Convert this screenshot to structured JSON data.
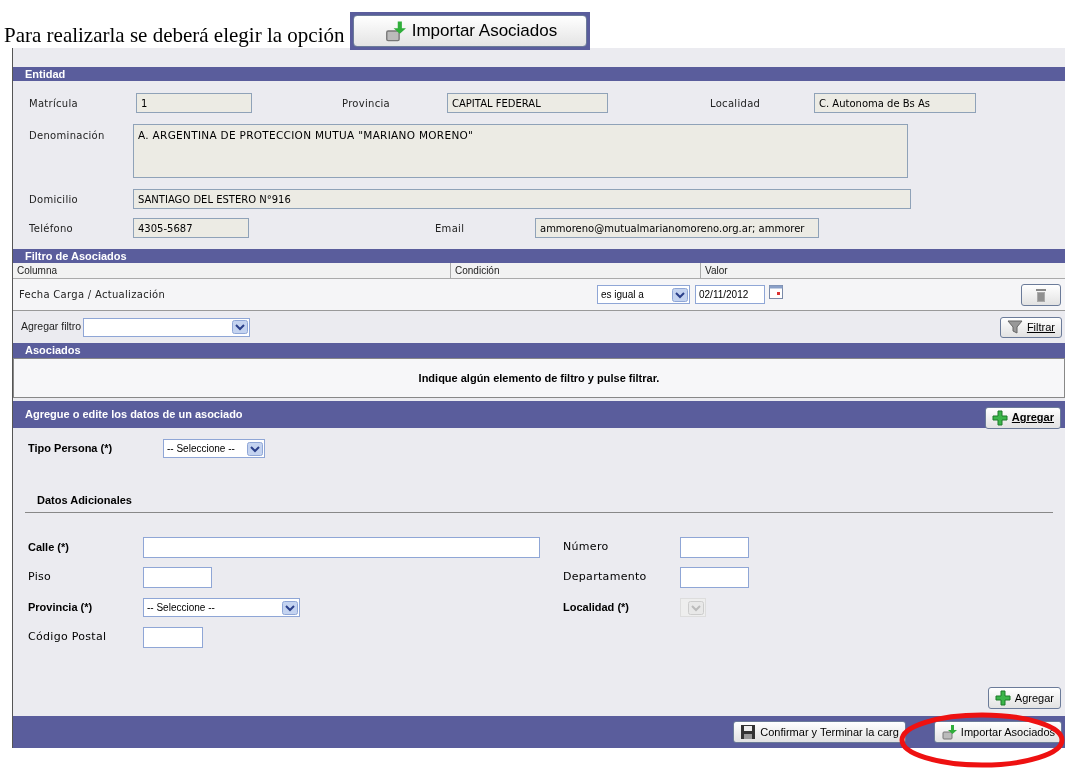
{
  "intro": {
    "text": "Para realizarla se deberá elegir la opción",
    "button_label": "Importar Asociados"
  },
  "entidad": {
    "title": "Entidad",
    "row_1": [
      {
        "label": "Matrícula",
        "value": "1"
      },
      {
        "label": "Provincia",
        "value": "CAPITAL FEDERAL"
      },
      {
        "label": "Localidad",
        "value": "C. Autonoma de Bs As"
      }
    ],
    "denominacion": {
      "label": "Denominación",
      "value": "A. ARGENTINA DE PROTECCION MUTUA \"MARIANO MORENO\""
    },
    "domicilio": {
      "label": "Domicilio",
      "value": "SANTIAGO DEL ESTERO N°916"
    },
    "row_4": [
      {
        "label": "Teléfono",
        "value": "4305-5687"
      },
      {
        "label": "Email",
        "value": "ammoreno@mutualmarianomoreno.org.ar; ammorer"
      }
    ]
  },
  "filtro": {
    "title": "Filtro de Asociados",
    "columns": [
      "Columna",
      "Condición",
      "Valor"
    ],
    "rows": [
      {
        "column": "Fecha Carga / Actualización",
        "condition": "es igual a",
        "value": "02/11/2012"
      }
    ],
    "add_filter_label": "Agregar filtro",
    "filter_button": "Filtrar"
  },
  "asociados": {
    "title": "Asociados",
    "message": "Indique algún elemento de filtro y pulse filtrar."
  },
  "editor": {
    "title": "Agregue o edite los datos de un asociado",
    "add_button": "Agregar",
    "tipo_persona": {
      "label": "Tipo Persona (*)",
      "value": "-- Seleccione --"
    },
    "section_title": "Datos Adicionales",
    "fields": [
      {
        "kind": "input",
        "label": "Calle (*)",
        "required": true
      },
      {
        "kind": "input",
        "label": "Número",
        "required": false
      },
      {
        "kind": "input",
        "label": "Piso",
        "required": false
      },
      {
        "kind": "input",
        "label": "Departamento",
        "required": false
      },
      {
        "kind": "select",
        "label": "Provincia (*)",
        "required": true,
        "value": "-- Seleccione --",
        "disabled": false
      },
      {
        "kind": "select",
        "label": "Localidad (*)",
        "required": true,
        "disabled": true
      },
      {
        "kind": "input",
        "label": "Código Postal",
        "required": false
      }
    ],
    "bottom_add_button": "Agregar"
  },
  "footer": {
    "buttons": [
      {
        "label": "Confirmar y Terminar la carg",
        "kind": "save"
      },
      {
        "label": "Importar Asociados",
        "kind": "import"
      }
    ]
  },
  "annotation": {
    "kind": "ellipse"
  }
}
